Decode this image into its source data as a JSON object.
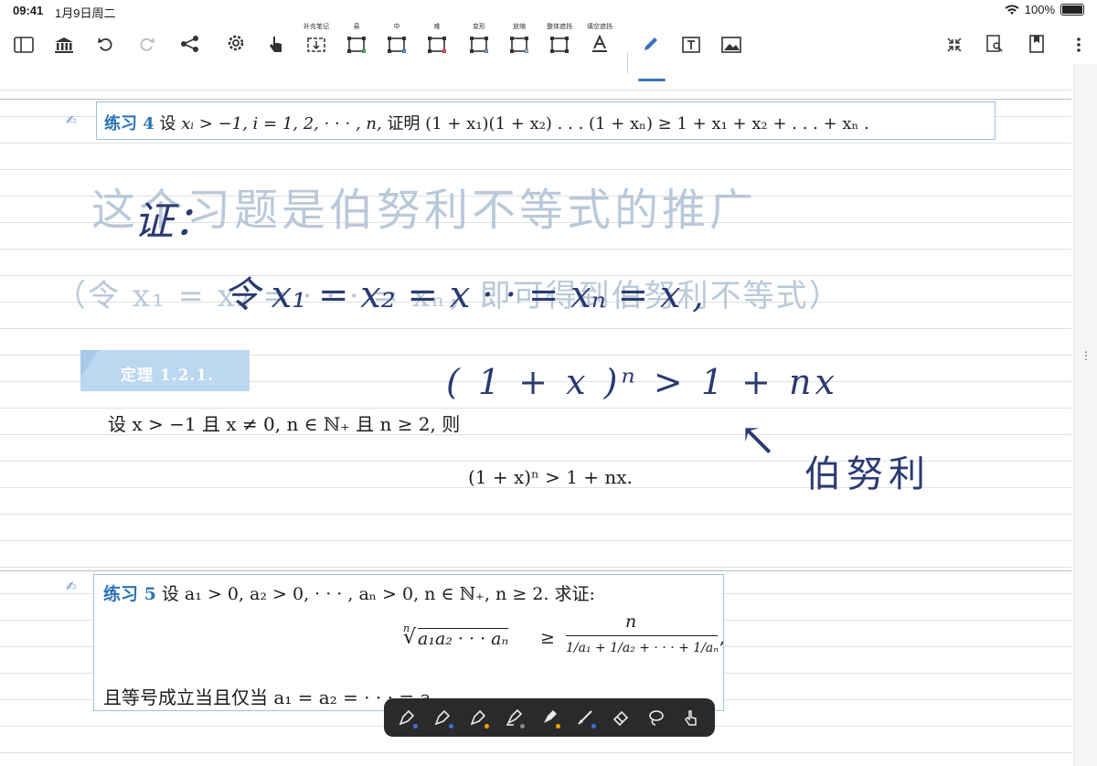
{
  "status_bar": {
    "time": "09:41",
    "date": "1月9日周二",
    "battery": "100%"
  },
  "toolbar": {
    "labels": {
      "supplement": "补充笔记",
      "easy": "易",
      "medium": "中",
      "hard": "难",
      "variant": "变形",
      "zoom": "放缩",
      "whole_mask": "整体遮挡",
      "fill_mask": "填空遮挡"
    },
    "colors": {
      "easy": "#4caf50",
      "medium": "#4a90e2",
      "hard": "#e94b6a",
      "variant": "#7b8fd1",
      "zoom": "#9aa9c8",
      "active": "#3d73b8"
    }
  },
  "exercise4": {
    "title": "练习 4",
    "statement_pre": "设",
    "statement_math": "xᵢ > −1, i = 1, 2, · · · , n,",
    "statement_mid": "证明",
    "statement_formula": "(1 + x₁)(1 + x₂) . . . (1 + xₙ) ≥ 1 + x₁ + x₂ + . . . + xₙ ."
  },
  "handwriting": {
    "faded_line1": "这个习题是伯努利不等式的推广",
    "faded_line2": "（令 x₁ = x₂ = · · · = xₙ，即可得到伯努利不等式）",
    "ink_proof": "证：",
    "ink_let": "令  x₁ = x₂ = x · · = xₙ = x ,",
    "ink_formula": "( 1 + x )ⁿ > 1 + nx",
    "ink_arrow": "↖",
    "ink_name": "伯努利"
  },
  "theorem": {
    "tag": "定理 1.2.1.",
    "line1": "设 x > −1 且 x ≠ 0, n ∈ ℕ₊ 且 n ≥ 2, 则",
    "formula": "(1 + x)ⁿ > 1 + nx."
  },
  "exercise5": {
    "title": "练习 5",
    "statement": "设 a₁ > 0, a₂ > 0, · · · , aₙ > 0, n ∈ ℕ₊, n ≥ 2. 求证:",
    "root_index": "n",
    "root_body": "a₁a₂ · · · aₙ",
    "geq": "≥",
    "numerator": "n",
    "denominator": "1/a₁ + 1/a₂ + · · · + 1/aₙ",
    "trailing_comma": ",",
    "bottom_line": "且等号成立当且仅当 a₁ = a₂ = · · · = aₙ"
  },
  "pen_tools": {
    "dot_colors": [
      "#3a6fd8",
      "#3a6fd8",
      "#f0a500",
      "#8a8a8a",
      "#f0a500",
      "#3a6fd8"
    ]
  }
}
